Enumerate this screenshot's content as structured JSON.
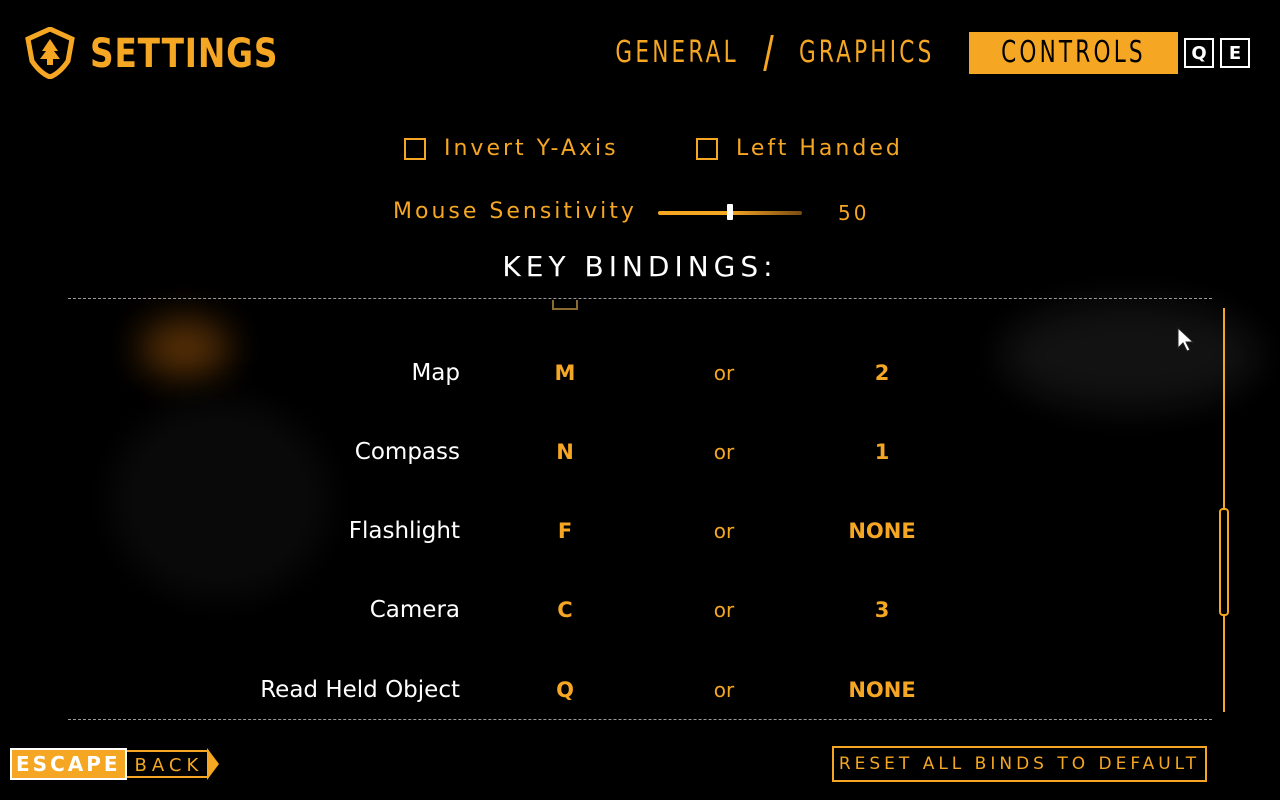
{
  "header": {
    "title": "SETTINGS",
    "tabs": [
      {
        "label": "GENERAL",
        "active": false
      },
      {
        "label": "GRAPHICS",
        "active": false
      },
      {
        "label": "CONTROLS",
        "active": true
      }
    ],
    "prev_tab_key": "Q",
    "next_tab_key": "E"
  },
  "options": {
    "invert_y": {
      "label": "Invert Y-Axis",
      "checked": false
    },
    "left_handed": {
      "label": "Left Handed",
      "checked": false
    },
    "mouse_sensitivity": {
      "label": "Mouse Sensitivity",
      "value": "50",
      "fraction": 0.5
    }
  },
  "key_bindings": {
    "heading": "KEY BINDINGS:",
    "or_label": "or",
    "rows": [
      {
        "action": "Map",
        "primary": "M",
        "secondary": "2"
      },
      {
        "action": "Compass",
        "primary": "N",
        "secondary": "1"
      },
      {
        "action": "Flashlight",
        "primary": "F",
        "secondary": "NONE"
      },
      {
        "action": "Camera",
        "primary": "C",
        "secondary": "3"
      },
      {
        "action": "Read Held Object",
        "primary": "Q",
        "secondary": "NONE"
      }
    ]
  },
  "footer": {
    "escape_key": "ESCAPE",
    "back_label": "BACK",
    "reset_label": "RESET ALL BINDS TO DEFAULT"
  },
  "colors": {
    "accent": "#f5a623",
    "background": "#000000",
    "text_primary": "#ffffff"
  },
  "icons": {
    "logo": "shield-tree-icon",
    "cursor": "mouse-pointer-icon"
  }
}
